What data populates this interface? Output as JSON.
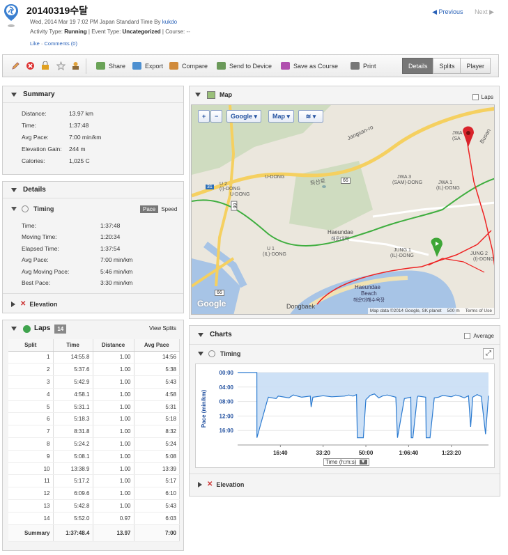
{
  "header": {
    "title": "20140319수달",
    "datetime": "Wed, 2014 Mar 19 7:02 PM Japan Standard Time By ",
    "author": "kukdo",
    "activity_type_label": "Activity Type:",
    "activity_type": "Running",
    "event_type_label": "Event Type:",
    "event_type": "Uncategorized",
    "course_label": "Course:",
    "course": "--",
    "like": "Like",
    "comments": "Comments (0)",
    "previous": "Previous",
    "next": "Next"
  },
  "toolbar": {
    "share": "Share",
    "export": "Export",
    "compare": "Compare",
    "send_to_device": "Send to Device",
    "save_as_course": "Save as Course",
    "print": "Print",
    "tabs": [
      "Details",
      "Splits",
      "Player"
    ]
  },
  "summary": {
    "title": "Summary",
    "rows": [
      {
        "label": "Distance:",
        "value": "13.97 km"
      },
      {
        "label": "Time:",
        "value": "1:37:48"
      },
      {
        "label": "Avg Pace:",
        "value": "7:00 min/km"
      },
      {
        "label": "Elevation Gain:",
        "value": "244 m"
      },
      {
        "label": "Calories:",
        "value": "1,025 C"
      }
    ]
  },
  "details": {
    "title": "Details",
    "timing_title": "Timing",
    "pace_toggle": "Pace",
    "speed_toggle": "Speed",
    "rows": [
      {
        "label": "Time:",
        "value": "1:37:48"
      },
      {
        "label": "Moving Time:",
        "value": "1:20:34"
      },
      {
        "label": "Elapsed Time:",
        "value": "1:37:54"
      },
      {
        "label": "Avg Pace:",
        "value": "7:00 min/km"
      },
      {
        "label": "Avg Moving Pace:",
        "value": "5:46 min/km"
      },
      {
        "label": "Best Pace:",
        "value": "3:30 min/km"
      }
    ],
    "elevation_title": "Elevation"
  },
  "laps": {
    "title": "Laps",
    "count": "14",
    "view_splits": "View Splits",
    "columns": [
      "Split",
      "Time",
      "Distance",
      "Avg Pace"
    ],
    "rows": [
      [
        "1",
        "14:55.8",
        "1.00",
        "14:56"
      ],
      [
        "2",
        "5:37.6",
        "1.00",
        "5:38"
      ],
      [
        "3",
        "5:42.9",
        "1.00",
        "5:43"
      ],
      [
        "4",
        "4:58.1",
        "1.00",
        "4:58"
      ],
      [
        "5",
        "5:31.1",
        "1.00",
        "5:31"
      ],
      [
        "6",
        "5:18.3",
        "1.00",
        "5:18"
      ],
      [
        "7",
        "8:31.8",
        "1.00",
        "8:32"
      ],
      [
        "8",
        "5:24.2",
        "1.00",
        "5:24"
      ],
      [
        "9",
        "5:08.1",
        "1.00",
        "5:08"
      ],
      [
        "10",
        "13:38.9",
        "1.00",
        "13:39"
      ],
      [
        "11",
        "5:17.2",
        "1.00",
        "5:17"
      ],
      [
        "12",
        "6:09.6",
        "1.00",
        "6:10"
      ],
      [
        "13",
        "5:42.8",
        "1.00",
        "5:43"
      ],
      [
        "14",
        "5:52.0",
        "0.97",
        "6:03"
      ]
    ],
    "summary_row": [
      "Summary",
      "1:37:48.4",
      "13.97",
      "7:00"
    ]
  },
  "map": {
    "title": "Map",
    "laps_label": "Laps",
    "zoom_in": "+",
    "zoom_out": "−",
    "provider": "Google",
    "map_type": "Map",
    "labels": {
      "jangsan": "Jangsan-ro",
      "busan": "Busan",
      "jwa_sa": "JWA",
      "jwa_sa2": "(SA",
      "u_dong": "U-DONG",
      "u2": "U 2",
      "u2b": "(I)-DONG",
      "u1": "U 1",
      "u1b": "(IL)-DONG",
      "jangsanro": "좌산로",
      "jwa3": "JWA 3",
      "jwa3b": "(SAM)-DONG",
      "jwa1": "JWA 1",
      "jwa1b": "(IL)-DONG",
      "haeundae": "Haeundae",
      "haeundae_kr": "해운대역",
      "jung1": "JUNG 1",
      "jung1b": "(IL)-DONG",
      "jung2": "JUNG 2",
      "jung2b": "(I)-DONG",
      "haeundae_beach": "Haeundae",
      "beach": "Beach",
      "beach_kr": "해운대해수욕장",
      "dongbaek": "Dongbaek",
      "u_dong2": "U-DONG",
      "route31": "31",
      "route66": "66",
      "route66b": "66",
      "route66c": "66"
    },
    "attribution": "Map data ©2014 Google, SK planet",
    "scale": "500 m",
    "terms": "Terms of Use",
    "logo": "Google"
  },
  "charts": {
    "title": "Charts",
    "average_label": "Average",
    "timing_title": "Timing",
    "elevation_title": "Elevation",
    "x_selector": "Time (h:m:s)"
  },
  "chart_data": {
    "type": "area",
    "title": "Timing",
    "xlabel": "Time (h:m:s)",
    "ylabel": "Pace (min/km)",
    "ylim_inverted": true,
    "yticks": [
      "00:00",
      "04:00",
      "08:00",
      "12:00",
      "16:00"
    ],
    "xticks": [
      "16:40",
      "33:20",
      "50:00",
      "1:06:40",
      "1:23:20"
    ],
    "x_seconds_range": [
      0,
      5868
    ],
    "y_minutes_range": [
      0,
      20
    ],
    "series": [
      {
        "values_x_seconds": [
          0,
          450,
          451,
          700,
          720,
          900,
          950,
          1200,
          1300,
          1500,
          1700,
          1720,
          1760,
          2000,
          2200,
          2500,
          2600,
          2700,
          2780,
          2800,
          2940,
          3000,
          3100,
          3200,
          3300,
          3400,
          3500,
          3600,
          3700,
          3740,
          3900,
          4050,
          4060,
          4100,
          4200,
          4220,
          4400,
          4410,
          4500,
          4600,
          4700,
          4800,
          5000,
          5100,
          5200,
          5300,
          5400,
          5450,
          5500,
          5600,
          5700,
          5800,
          5868
        ],
        "values_pace_minutes": [
          0,
          0,
          18,
          7.5,
          6.8,
          7.2,
          6.5,
          7.0,
          6.2,
          6.8,
          6.5,
          9.5,
          6.8,
          6.4,
          6.7,
          6.5,
          6.2,
          6.5,
          6.1,
          18,
          18,
          7.5,
          6.3,
          5.9,
          7.0,
          6.4,
          6.2,
          6.5,
          6.8,
          18,
          7.2,
          6.8,
          18,
          18,
          7.0,
          6.5,
          6.8,
          18,
          18,
          7.0,
          6.8,
          6.3,
          6.7,
          6.2,
          6.5,
          7.0,
          6.4,
          15,
          6.8,
          6.1,
          6.6,
          17,
          6.4
        ]
      }
    ]
  }
}
